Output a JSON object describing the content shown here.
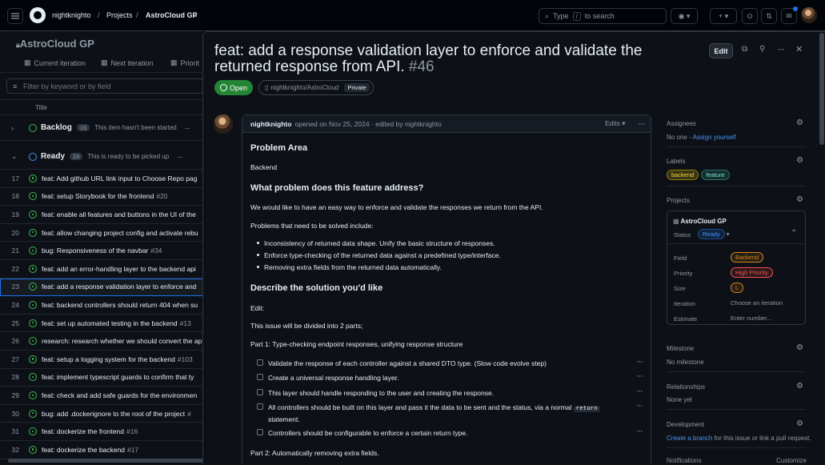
{
  "topbar": {
    "user": "nightknighto",
    "projects": "Projects",
    "project": "AstroCloud GP",
    "search_prefix": "Type",
    "search_key": "/",
    "search_suffix": "to search"
  },
  "board": {
    "title": "AstroCloud GP",
    "views": [
      "Current iteration",
      "Next iteration",
      "Priorit"
    ],
    "filter_placeholder": "Filter by keyword or by field",
    "column_title": "Title",
    "groups": [
      {
        "name": "Backlog",
        "count": "16",
        "desc": "This item hasn't been started"
      },
      {
        "name": "Ready",
        "count": "24",
        "desc": "This is ready to be picked up"
      }
    ],
    "items": [
      {
        "num": "17",
        "title": "feat: Add github URL link input to Choose Repo pag",
        "ref": ""
      },
      {
        "num": "18",
        "title": "feat: setup Storybook for the frontend",
        "ref": "#20"
      },
      {
        "num": "19",
        "title": "feat: enable all features and buttons in the UI of the",
        "ref": ""
      },
      {
        "num": "20",
        "title": "feat: allow changing project config and activate rebu",
        "ref": ""
      },
      {
        "num": "21",
        "title": "bug: Responsiveness of the navbar",
        "ref": "#34"
      },
      {
        "num": "22",
        "title": "feat: add an error-handling layer to the backend api",
        "ref": ""
      },
      {
        "num": "23",
        "title": "feat: add a response validation layer to enforce and",
        "ref": ""
      },
      {
        "num": "24",
        "title": "feat: backend controllers should return 404 when su",
        "ref": ""
      },
      {
        "num": "25",
        "title": "feat: set up automated testing in the backend",
        "ref": "#13"
      },
      {
        "num": "26",
        "title": "research: research whether we should convert the ap",
        "ref": ""
      },
      {
        "num": "27",
        "title": "feat: setup a logging system for the backend",
        "ref": "#103"
      },
      {
        "num": "28",
        "title": "feat: implement typescript guards to confirm that ty",
        "ref": ""
      },
      {
        "num": "29",
        "title": "feat: check and add safe guards for the environmen",
        "ref": ""
      },
      {
        "num": "30",
        "title": "bug: add .dockerignore to the root of the project",
        "ref": "#"
      },
      {
        "num": "31",
        "title": "feat: dockerize the frontend",
        "ref": "#16"
      },
      {
        "num": "32",
        "title": "feat: dockerize the backend",
        "ref": "#17"
      }
    ]
  },
  "issue": {
    "title": "feat: add a response validation layer to enforce and validate the returned response from API.",
    "number": "#46",
    "edit_label": "Edit",
    "state": "Open",
    "repo": "nightknighto/AstroCloud",
    "visibility": "Private",
    "author": "nightknighto",
    "meta": "opened on Nov 25, 2024 · edited by nightknighto",
    "edits_label": "Edits",
    "body": {
      "h_problem": "Problem Area",
      "problem_area": "Backend",
      "h_what": "What problem does this feature address?",
      "what_text": "We would like to have an easy way to enforce and validate the responses we return from the API.",
      "problems_intro": "Problems that need to be solved include:",
      "problems": [
        "Inconsistency of returned data shape. Unify the basic structure of responses.",
        "Enforce type-checking of the returned data against a predefined type/interface.",
        "Removing extra fields from the returned data automatically."
      ],
      "h_solution": "Describe the solution you'd like",
      "edit_note": "Edit:",
      "parts_intro": "This issue will be divided into 2 parts;",
      "part1": "Part 1: Type-checking endpoint responses, unifying response structure",
      "tasks": [
        "Validate the response of each controller against a shared DTO type. (Slow code evolve step)",
        "Create a universal response handling layer.",
        "This layer should handle responding to the user and creating the response.",
        "All controllers should be built on this layer and pass it the data to be sent and the status, via a normal",
        "Controllers should be configurable to enforce a certain return type."
      ],
      "task4_code": "return",
      "task4_rest": "statement.",
      "part2": "Part 2: Automatically removing extra fields."
    }
  },
  "sidebar": {
    "assignees_label": "Assignees",
    "assignees_value": "No one -",
    "assign_yourself": "Assign yourself",
    "labels_label": "Labels",
    "labels": [
      {
        "name": "backend",
        "color": "#d4c21f"
      },
      {
        "name": "feature",
        "color": "#7ee0d8"
      }
    ],
    "projects_label": "Projects",
    "project_name": "AstroCloud GP",
    "status_label": "Status",
    "status_value": "Ready",
    "fields": [
      {
        "name": "Field",
        "value": "Backend",
        "color": "#d18616"
      },
      {
        "name": "Priority",
        "value": "High Priority",
        "color": "#f85149"
      },
      {
        "name": "Size",
        "value": "L",
        "color": "#d18616"
      },
      {
        "name": "Iteration",
        "value": "Choose an iteration",
        "color": ""
      },
      {
        "name": "Estimate",
        "value": "Enter number...",
        "color": ""
      }
    ],
    "milestone_label": "Milestone",
    "milestone_value": "No milestone",
    "relationships_label": "Relationships",
    "relationships_value": "None yet",
    "development_label": "Development",
    "create_branch": "Create a branch",
    "development_suffix": "for this issue or link a pull request.",
    "notifications_label": "Notifications",
    "customize": "Customize"
  }
}
